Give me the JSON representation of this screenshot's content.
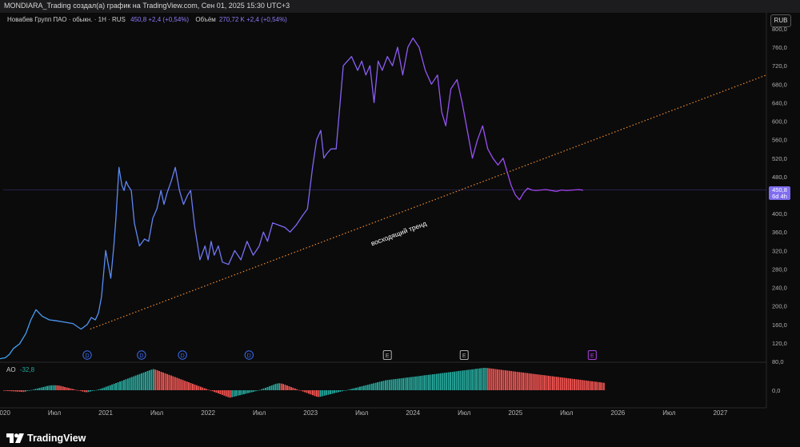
{
  "header": {
    "caption": "MONDIARA_Trading создал(а) график на TradingView.com, Сен 01, 2025 15:30 UTC+3"
  },
  "legend": {
    "symbol": "Новабев Групп ПАО · обыкн. · 1Н · RUS",
    "change": "450,8  +2,4 (+0,54%)",
    "volume_label": "Объём",
    "volume_value": "270,72 K  +2,4 (+0,54%)"
  },
  "currency_button": "RUB",
  "price_tag": {
    "price": "450,8",
    "countdown": "6d 4h"
  },
  "ao": {
    "name": "AO",
    "value": "-32,8"
  },
  "brand": "TradingView",
  "colors": {
    "background": "#0b0b0c",
    "line_start": "#3fa3f0",
    "line_end": "#a642f0",
    "trendline": "#ef8a2a",
    "ao_up": "#26a69a",
    "ao_down": "#ef5350",
    "price_tag": "#7e6df0",
    "event_div": "#3b6cf0",
    "event_earn": "#b0b0b0",
    "event_future": "#b040e0"
  },
  "chart_data": [
    {
      "type": "line",
      "title": "Новабев Групп ПАО · обыкн. · 1Н · RUS",
      "ylabel": "RUB",
      "ylim": [
        80,
        800
      ],
      "y_ticks": [
        80,
        120,
        160,
        200,
        240,
        280,
        320,
        360,
        400,
        440,
        480,
        520,
        560,
        600,
        640,
        680,
        720,
        760,
        800
      ],
      "y_tick_labels": [
        "80,0",
        "120,0",
        "160,0",
        "200,0",
        "240,0",
        "280,0",
        "320,0",
        "360,0",
        "400,0",
        "440,0",
        "480,0",
        "520,0",
        "560,0",
        "600,0",
        "640,0",
        "680,0",
        "720,0",
        "760,0",
        "800,0"
      ],
      "xlim": [
        2020.0,
        2027.45
      ],
      "x_ticks": [
        2020.0,
        2020.5,
        2021.0,
        2021.5,
        2022.0,
        2022.5,
        2023.0,
        2023.5,
        2024.0,
        2024.5,
        2025.0,
        2025.5,
        2026.0,
        2026.5,
        2027.0
      ],
      "x_tick_labels": [
        "2020",
        "Июл",
        "2021",
        "Июл",
        "2022",
        "Июл",
        "2023",
        "Июл",
        "2024",
        "Июл",
        "2025",
        "Июл",
        "2026",
        "Июл",
        "2027"
      ],
      "grid": false,
      "series": [
        {
          "x": [
            2019.95,
            2020.02,
            2020.06,
            2020.1,
            2020.16,
            2020.22,
            2020.27,
            2020.32,
            2020.38,
            2020.45,
            2020.52,
            2020.6,
            2020.68,
            2020.76,
            2020.82,
            2020.86,
            2020.9,
            2020.93,
            2020.96,
            2021.0,
            2021.05,
            2021.08,
            2021.1,
            2021.13,
            2021.16,
            2021.18,
            2021.2,
            2021.22,
            2021.25,
            2021.28,
            2021.33,
            2021.38,
            2021.42,
            2021.46,
            2021.5,
            2021.54,
            2021.57,
            2021.6,
            2021.64,
            2021.68,
            2021.72,
            2021.76,
            2021.8,
            2021.83,
            2021.87,
            2021.92,
            2021.97,
            2022.0,
            2022.03,
            2022.06,
            2022.1,
            2022.14,
            2022.2,
            2022.26,
            2022.32,
            2022.38,
            2022.44,
            2022.5,
            2022.54,
            2022.58,
            2022.63,
            2022.69,
            2022.75,
            2022.8,
            2022.86,
            2022.92,
            2022.97,
            2023.02,
            2023.06,
            2023.1,
            2023.13,
            2023.16,
            2023.2,
            2023.25,
            2023.32,
            2023.4,
            2023.46,
            2023.5,
            2023.54,
            2023.58,
            2023.62,
            2023.66,
            2023.7,
            2023.75,
            2023.8,
            2023.85,
            2023.9,
            2023.95,
            2024.0,
            2024.06,
            2024.12,
            2024.18,
            2024.24,
            2024.28,
            2024.32,
            2024.37,
            2024.43,
            2024.48,
            2024.53,
            2024.58,
            2024.63,
            2024.68,
            2024.73,
            2024.78,
            2024.83,
            2024.88,
            2024.92,
            2024.96,
            2025.0,
            2025.04,
            2025.08,
            2025.12,
            2025.16,
            2025.2,
            2025.25,
            2025.3,
            2025.35,
            2025.4,
            2025.45,
            2025.5,
            2025.56,
            2025.62,
            2025.66
          ],
          "y": [
            85,
            88,
            95,
            108,
            118,
            140,
            170,
            192,
            178,
            170,
            168,
            165,
            162,
            150,
            160,
            175,
            170,
            185,
            220,
            320,
            260,
            330,
            390,
            500,
            460,
            450,
            470,
            460,
            450,
            380,
            330,
            345,
            340,
            390,
            410,
            450,
            420,
            445,
            470,
            500,
            450,
            420,
            440,
            450,
            370,
            300,
            330,
            300,
            340,
            310,
            330,
            295,
            290,
            320,
            300,
            340,
            310,
            330,
            360,
            340,
            380,
            375,
            370,
            360,
            375,
            395,
            410,
            500,
            560,
            580,
            520,
            530,
            540,
            540,
            720,
            740,
            710,
            730,
            700,
            720,
            640,
            730,
            710,
            740,
            720,
            760,
            700,
            760,
            780,
            760,
            710,
            680,
            700,
            620,
            590,
            670,
            690,
            640,
            580,
            520,
            560,
            590,
            540,
            520,
            505,
            520,
            490,
            460,
            440,
            430,
            445,
            455,
            451,
            450,
            451,
            452,
            450,
            448,
            451,
            450,
            451,
            452,
            450.8
          ]
        }
      ]
    },
    {
      "type": "bar",
      "title": "AO",
      "ylim": [
        -30,
        90
      ],
      "y_tick_labels": [
        "0,0"
      ],
      "series": [
        {
          "name": "AO",
          "x_start": 2020.0,
          "x_end": 2025.66,
          "x_step": 0.0192,
          "values": [
            -2,
            -2.5,
            -3,
            -3.5,
            -4,
            -4.5,
            -5,
            -5.5,
            -6,
            -6.5,
            -7,
            -5,
            -3,
            -1,
            1,
            3,
            5,
            7,
            9,
            11,
            13,
            15,
            17,
            18.5,
            19.5,
            20,
            20,
            19.5,
            18.5,
            17,
            15,
            13,
            11,
            9,
            7,
            5,
            3,
            1,
            -1,
            -3,
            -5,
            -7,
            -8,
            -7,
            -5,
            -3,
            -1,
            1,
            3,
            5,
            8,
            11,
            14,
            17,
            20,
            23,
            26,
            29,
            32,
            35,
            38,
            41,
            44,
            47,
            50,
            53,
            56,
            59,
            62,
            65,
            68,
            71,
            74,
            77,
            80,
            83,
            85,
            83,
            80,
            77,
            74,
            71,
            68,
            65,
            62,
            59,
            56,
            53,
            50,
            47,
            44,
            41,
            38,
            35,
            32,
            29,
            26,
            23,
            20,
            17,
            14,
            11,
            8,
            5,
            2,
            -1,
            -4,
            -7,
            -10,
            -13,
            -16,
            -19,
            -22,
            -25,
            -28,
            -30,
            -28,
            -26,
            -24,
            -22,
            -20,
            -18,
            -16,
            -14,
            -12,
            -10,
            -8,
            -6,
            -4,
            -2,
            1,
            4,
            7,
            10,
            13,
            16,
            19,
            22,
            25,
            27,
            28,
            27,
            25,
            22,
            19,
            16,
            13,
            10,
            7,
            4,
            1,
            -2,
            -5,
            -8,
            -11,
            -14,
            -17,
            -20,
            -23,
            -26,
            -27,
            -26,
            -24,
            -22,
            -20,
            -18,
            -16,
            -14,
            -12,
            -10,
            -8,
            -6,
            -4,
            -2,
            0,
            2,
            4,
            6,
            8,
            10,
            12,
            14,
            16,
            18,
            20,
            22,
            24,
            26,
            28,
            30,
            32,
            34,
            36,
            38,
            40,
            41,
            42,
            43,
            44,
            45,
            46,
            47,
            48,
            49,
            50,
            51,
            52,
            53,
            54,
            55,
            56,
            57,
            58,
            59,
            60,
            61,
            62,
            63,
            64,
            65,
            66,
            67,
            68,
            69,
            70,
            71,
            72,
            73,
            74,
            75,
            76,
            77,
            78,
            79,
            80,
            81,
            82,
            83,
            84,
            85,
            86,
            87,
            88,
            89,
            90,
            90,
            89,
            88,
            87,
            86,
            85,
            84,
            83,
            82,
            81,
            80,
            79,
            78,
            77,
            76,
            75,
            74,
            73,
            72,
            71,
            70,
            69,
            68,
            67,
            66,
            65,
            64,
            63,
            62,
            61,
            60,
            59,
            58,
            57,
            56,
            55,
            54,
            53,
            52,
            51,
            50,
            49,
            48,
            47,
            46,
            45,
            44,
            43,
            42,
            41,
            40,
            39,
            38,
            37,
            36,
            35,
            34,
            33,
            32,
            31,
            30
          ]
        }
      ]
    }
  ],
  "annotations": {
    "trend_label": "восходящий тренд",
    "events": [
      {
        "x": 2020.82,
        "label": "D",
        "kind": "div"
      },
      {
        "x": 2021.35,
        "label": "D",
        "kind": "div"
      },
      {
        "x": 2021.75,
        "label": "D",
        "kind": "div"
      },
      {
        "x": 2022.4,
        "label": "D",
        "kind": "div"
      },
      {
        "x": 2023.75,
        "label": "E",
        "kind": "earn"
      },
      {
        "x": 2024.5,
        "label": "E",
        "kind": "earn"
      },
      {
        "x": 2025.75,
        "label": "E",
        "kind": "future"
      }
    ],
    "trendline": {
      "x1": 2020.85,
      "y1": 150,
      "x2": 2027.45,
      "y2": 700
    }
  }
}
